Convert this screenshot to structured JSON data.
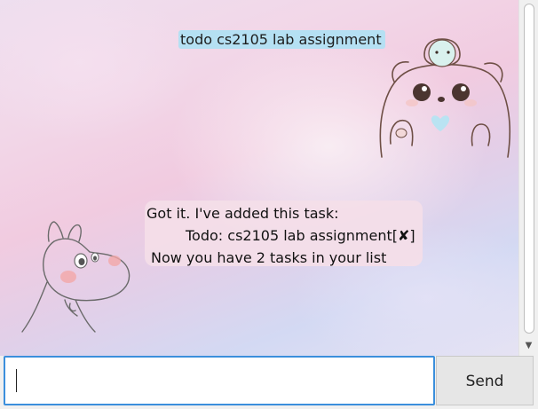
{
  "chat": {
    "messages": [
      {
        "sender": "user",
        "text": "todo cs2105 lab assignment"
      },
      {
        "sender": "bot",
        "line1": "Got it. I've added this task:",
        "line2_prefix": "Todo:  cs2105 lab assignment[",
        "line2_mark": "✘",
        "line2_suffix": "]",
        "line3": "Now you have 2 tasks in your list"
      }
    ],
    "user_avatar": "bear-avatar",
    "bot_avatar": "moomin-avatar"
  },
  "input": {
    "value": "",
    "placeholder": ""
  },
  "send_button": {
    "label": "Send"
  },
  "colors": {
    "user_bubble": "#b5e0f3",
    "bot_bubble": "#f4dee8",
    "input_focus_border": "#3b8fdc"
  }
}
